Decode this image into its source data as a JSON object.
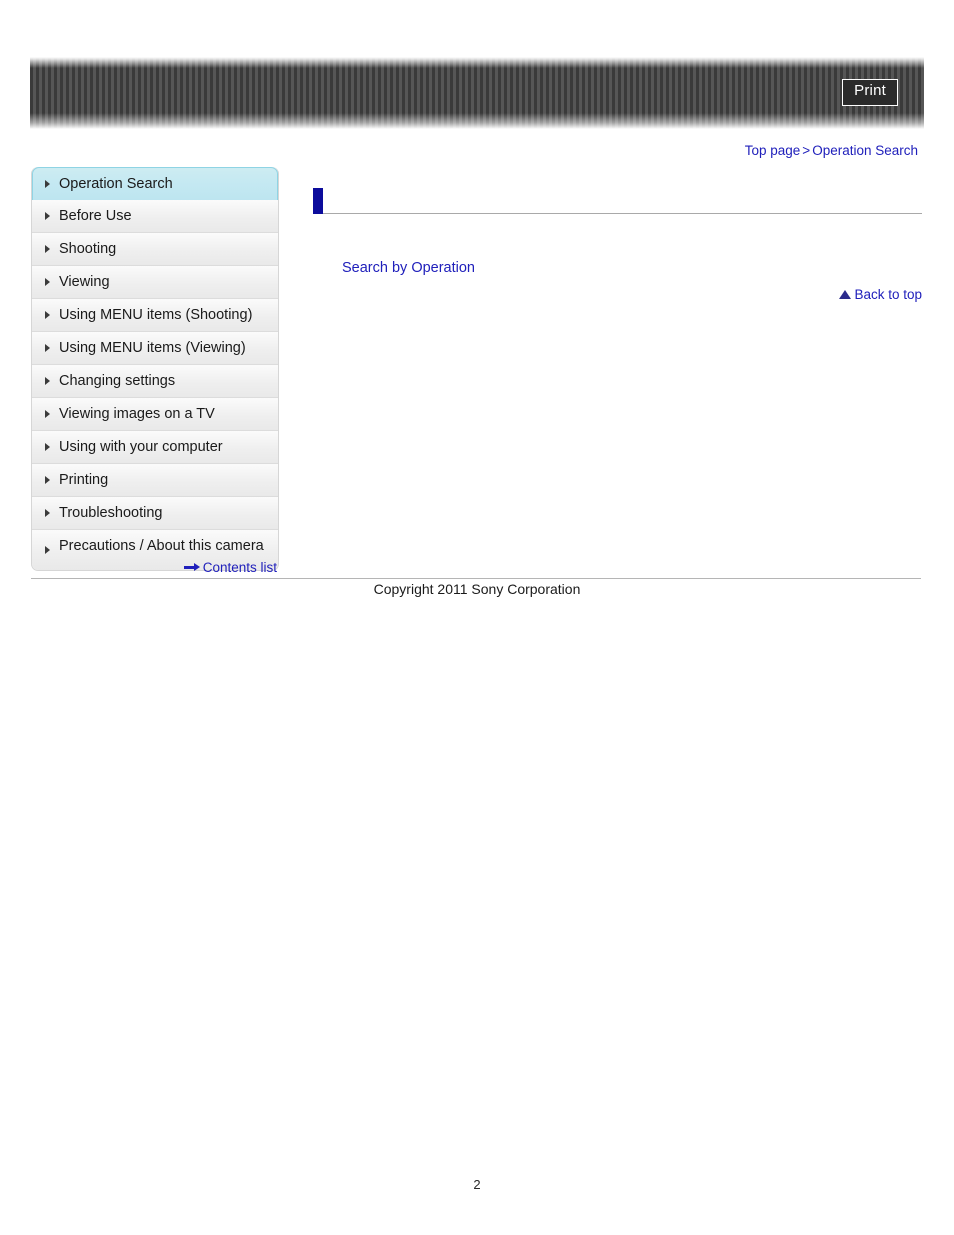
{
  "header": {
    "print_label": "Print",
    "stripe_color_dark": "#3a3a3a",
    "stripe_color_light": "#565656"
  },
  "breadcrumb": {
    "top_page": "Top page",
    "separator": ">",
    "current": "Operation Search"
  },
  "sidebar": {
    "items": [
      {
        "label": "Operation Search",
        "active": true
      },
      {
        "label": "Before Use",
        "active": false
      },
      {
        "label": "Shooting",
        "active": false
      },
      {
        "label": "Viewing",
        "active": false
      },
      {
        "label": "Using MENU items (Shooting)",
        "active": false
      },
      {
        "label": "Using MENU items (Viewing)",
        "active": false
      },
      {
        "label": "Changing settings",
        "active": false
      },
      {
        "label": "Viewing images on a TV",
        "active": false
      },
      {
        "label": "Using with your computer",
        "active": false
      },
      {
        "label": "Printing",
        "active": false
      },
      {
        "label": "Troubleshooting",
        "active": false
      },
      {
        "label": "Precautions / About this camera",
        "active": false
      }
    ],
    "contents_list_label": "Contents list"
  },
  "main": {
    "section_title": "",
    "search_link_label": "Search by Operation",
    "back_to_top_label": "Back to top",
    "accent_marker_color": "#0c0c9c",
    "link_color": "#2020bb"
  },
  "footer": {
    "copyright": "Copyright 2011 Sony Corporation",
    "page_number": "2"
  }
}
